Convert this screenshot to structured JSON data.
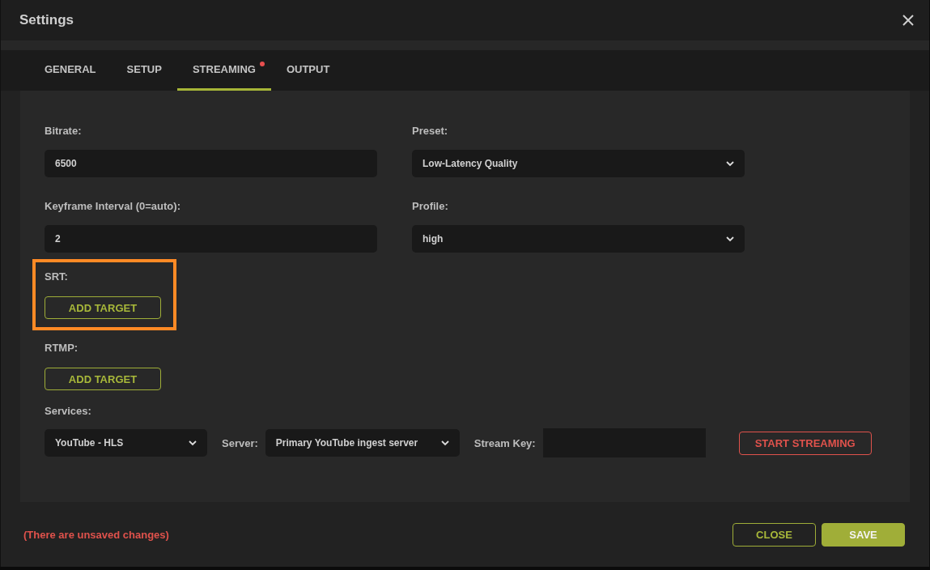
{
  "window": {
    "title": "Settings"
  },
  "tabs": [
    {
      "label": "GENERAL",
      "selected": false,
      "notification": false
    },
    {
      "label": "SETUP",
      "selected": false,
      "notification": false
    },
    {
      "label": "STREAMING",
      "selected": true,
      "notification": true
    },
    {
      "label": "OUTPUT",
      "selected": false,
      "notification": false
    }
  ],
  "fields": [
    {
      "kind": "input",
      "label": "Bitrate:",
      "value": "6500"
    },
    {
      "kind": "select",
      "label": "Preset:",
      "value": "Low-Latency Quality"
    },
    {
      "kind": "input",
      "label": "Keyframe Interval (0=auto):",
      "value": "2"
    },
    {
      "kind": "select",
      "label": "Profile:",
      "value": "high"
    }
  ],
  "targets": [
    {
      "label": "SRT:",
      "button": "ADD TARGET",
      "highlighted": true
    },
    {
      "label": "RTMP:",
      "button": "ADD TARGET",
      "highlighted": false
    }
  ],
  "services": {
    "label": "Services:",
    "service": "YouTube - HLS",
    "server_label": "Server:",
    "server": "Primary YouTube ingest server",
    "stream_key_label": "Stream Key:",
    "start_button": "START STREAMING"
  },
  "footer": {
    "warning": "(There are unsaved changes)",
    "buttons": [
      {
        "label": "CLOSE",
        "kind": "outline"
      },
      {
        "label": "SAVE",
        "kind": "filled"
      }
    ]
  }
}
